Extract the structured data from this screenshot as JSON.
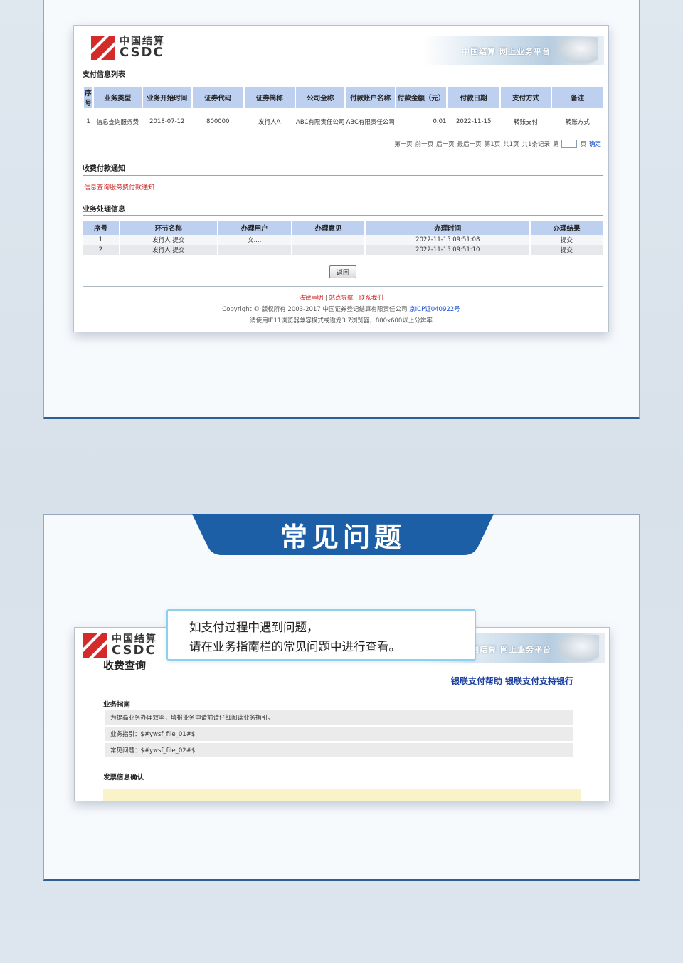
{
  "brand": {
    "logo_cn": "中国结算",
    "logo_en": "CSDC",
    "banner_text": "中国结算 网上业务平台"
  },
  "colors": {
    "accent": "#1d5fa6",
    "table_header": "#bdd0f0",
    "link_red": "#cc2222",
    "link_blue": "#1a4fd0",
    "callout_border": "#8cd0ee"
  },
  "screen1": {
    "payment_list": {
      "title": "支付信息列表",
      "headers": [
        "序号",
        "业务类型",
        "业务开始时间",
        "证券代码",
        "证券简称",
        "公司全称",
        "付款账户名称",
        "付款金额（元）",
        "付款日期",
        "支付方式",
        "备注"
      ],
      "rows": [
        [
          "1",
          "信息查询服务费",
          "2018-07-12",
          "800000",
          "发行人A",
          "ABC有限责任公司",
          "ABC有限责任公司",
          "0.01",
          "2022-11-15",
          "转账支付",
          "转账方式"
        ]
      ]
    },
    "pager": {
      "first": "第一页",
      "prev": "前一页",
      "next": "后一页",
      "last": "最后一页",
      "current": "第1页",
      "total_pages": "共1页",
      "total_records": "共1条记录",
      "goto_prefix": "第",
      "goto_suffix": "页",
      "confirm": "确定"
    },
    "fee_notice": {
      "title": "收费付款通知",
      "link": "信息查询服务费付款通知"
    },
    "process_info": {
      "title": "业务处理信息",
      "headers": [
        "序号",
        "环节名称",
        "办理用户",
        "办理意见",
        "办理时间",
        "办理结果"
      ],
      "rows": [
        [
          "1",
          "发行人 提交",
          "文....",
          "",
          "2022-11-15 09:51:08",
          "提交"
        ],
        [
          "2",
          "发行人 提交",
          "",
          "",
          "2022-11-15 09:51:10",
          "提交"
        ]
      ]
    },
    "back_button": "返回",
    "footer": {
      "link_legal": "法律声明",
      "link_sitemap": "站点导航",
      "link_contact": "联系我们",
      "separator": "|",
      "copyright": "Copyright © 版权所有 2003-2017 中国证券登记结算有限责任公司",
      "icp": "京ICP证040922号",
      "browser_note": "请使用IE11浏览器兼容模式或遨龙3.7浏览器，800x600以上分辨率"
    }
  },
  "faq_tab": {
    "title": "常见问题"
  },
  "callout": {
    "line1": "如支付过程中遇到问题，",
    "line2": "请在业务指南栏的常见问题中进行查看。"
  },
  "screen2": {
    "page_title": "收费查询",
    "links": "银联支付帮助 银联支付支持银行",
    "guide": {
      "title": "业务指南",
      "rows": [
        "为提高业务办理效率，填报业务申请前请仔细阅读业务指引。",
        "业务指引：$#ywsf_file_01#$",
        "常见问题：$#ywsf_file_02#$"
      ]
    },
    "invoice_title": "发票信息确认"
  }
}
